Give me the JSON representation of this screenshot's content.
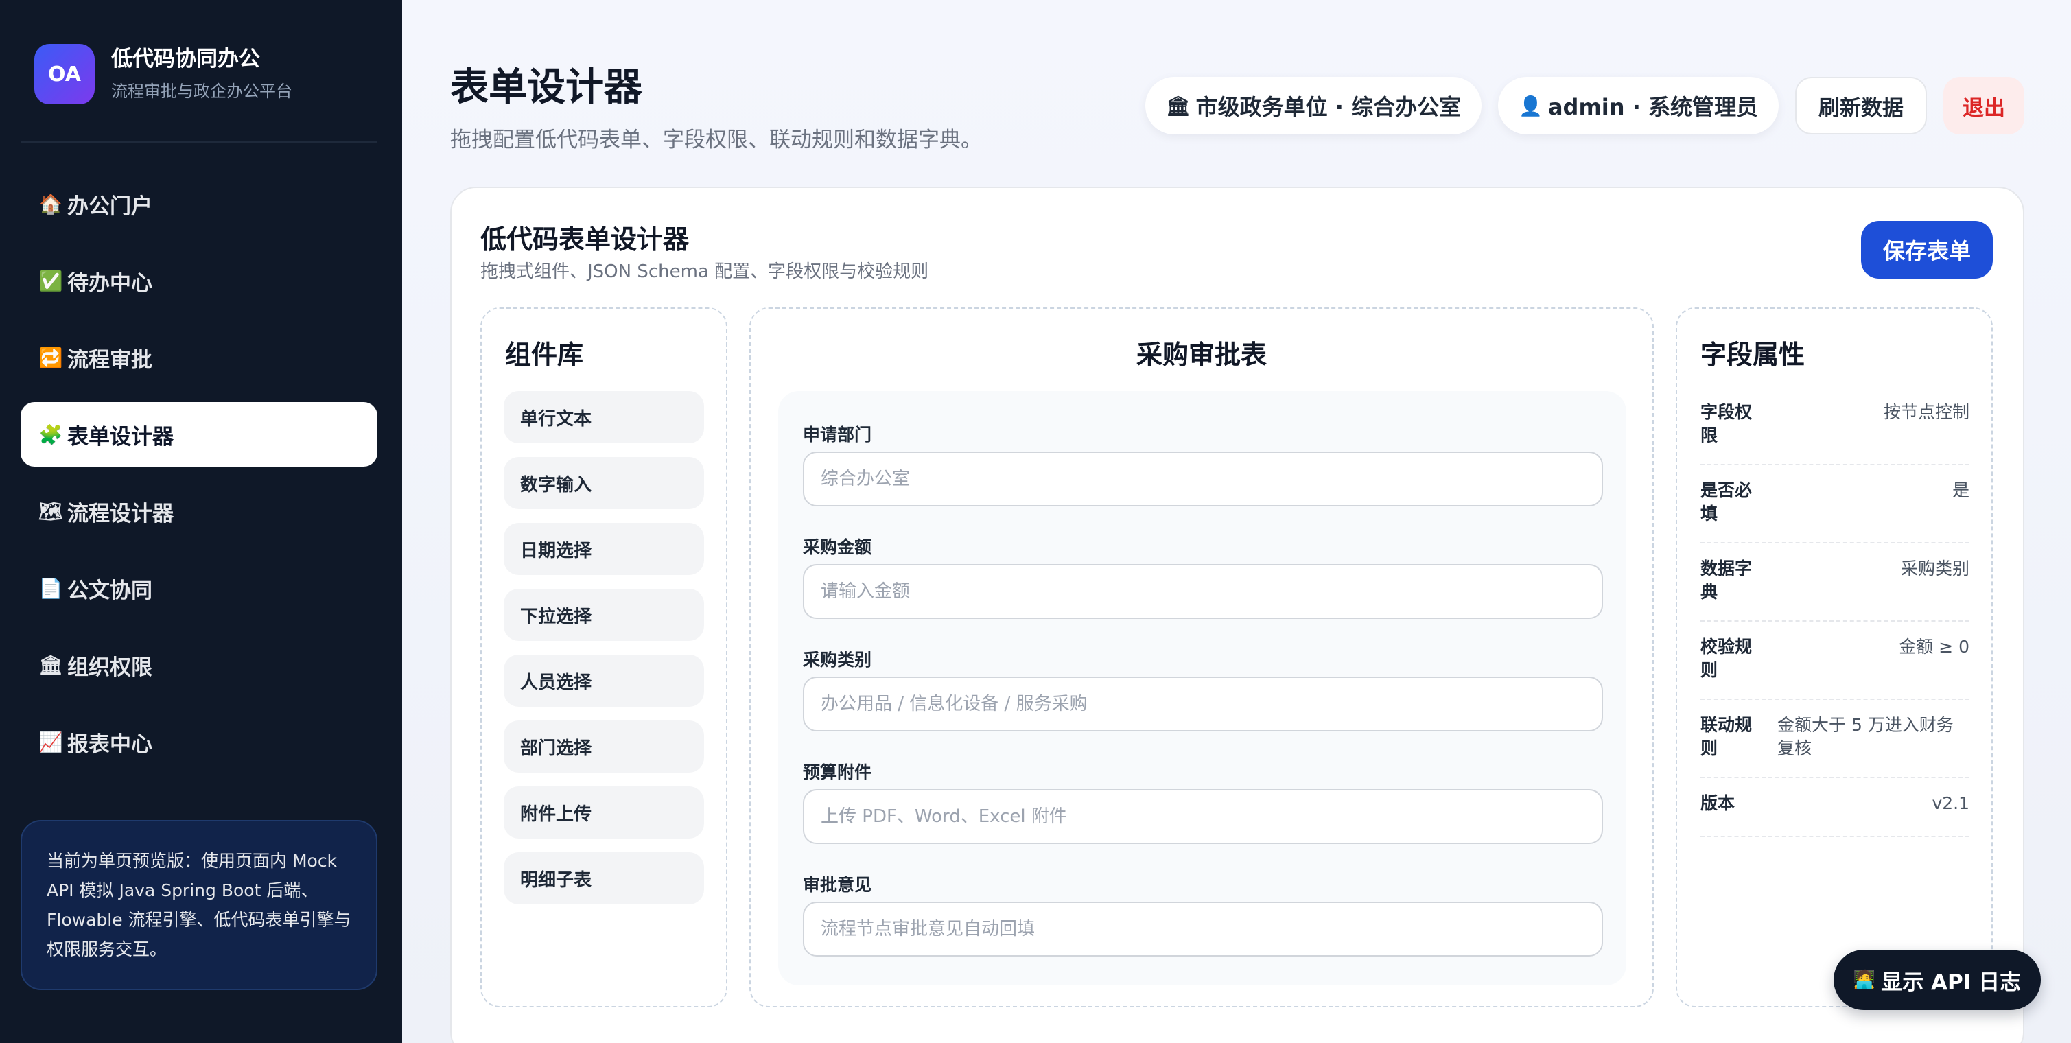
{
  "brand": {
    "logo": "OA",
    "name": "低代码协同办公",
    "subtitle": "流程审批与政企办公平台"
  },
  "sidebar": {
    "items": [
      {
        "icon": "🏠",
        "icon_name": "home-icon",
        "label": "办公门户",
        "active": false
      },
      {
        "icon": "✅",
        "icon_name": "check-icon",
        "label": "待办中心",
        "active": false
      },
      {
        "icon": "🔁",
        "icon_name": "repeat-icon",
        "label": "流程审批",
        "active": false
      },
      {
        "icon": "🧩",
        "icon_name": "puzzle-icon",
        "label": "表单设计器",
        "active": true
      },
      {
        "icon": "🗺",
        "icon_name": "map-icon",
        "label": "流程设计器",
        "active": false
      },
      {
        "icon": "📄",
        "icon_name": "document-icon",
        "label": "公文协同",
        "active": false
      },
      {
        "icon": "🏛",
        "icon_name": "building-icon",
        "label": "组织权限",
        "active": false
      },
      {
        "icon": "📈",
        "icon_name": "chart-icon",
        "label": "报表中心",
        "active": false
      }
    ],
    "note": "当前为单页预览版：使用页面内 Mock API 模拟 Java Spring Boot 后端、Flowable 流程引擎、低代码表单引擎与权限服务交互。"
  },
  "header": {
    "title": "表单设计器",
    "subtitle": "拖拽配置低代码表单、字段权限、联动规则和数据字典。",
    "org": {
      "icon": "🏛",
      "label": "市级政务单位 · 综合办公室"
    },
    "user": {
      "icon": "👤",
      "label": "admin · 系统管理员"
    },
    "refresh_label": "刷新数据",
    "logout_label": "退出"
  },
  "designer": {
    "title": "低代码表单设计器",
    "subtitle": "拖拽式组件、JSON Schema 配置、字段权限与校验规则",
    "save_label": "保存表单",
    "library": {
      "title": "组件库",
      "components": [
        "单行文本",
        "数字输入",
        "日期选择",
        "下拉选择",
        "人员选择",
        "部门选择",
        "附件上传",
        "明细子表"
      ]
    },
    "form": {
      "title": "采购审批表",
      "fields": [
        {
          "label": "申请部门",
          "placeholder": "综合办公室"
        },
        {
          "label": "采购金额",
          "placeholder": "请输入金额"
        },
        {
          "label": "采购类别",
          "placeholder": "办公用品 / 信息化设备 / 服务采购"
        },
        {
          "label": "预算附件",
          "placeholder": "上传 PDF、Word、Excel 附件"
        },
        {
          "label": "审批意见",
          "placeholder": "流程节点审批意见自动回填"
        }
      ]
    },
    "props": {
      "title": "字段属性",
      "rows": [
        {
          "key": "字段权限",
          "value": "按节点控制"
        },
        {
          "key": "是否必填",
          "value": "是"
        },
        {
          "key": "数据字典",
          "value": "采购类别"
        },
        {
          "key": "校验规则",
          "value": "金额 ≥ 0"
        },
        {
          "key": "联动规则",
          "value": "金额大于 5 万进入财务复核"
        },
        {
          "key": "版本",
          "value": "v2.1"
        }
      ]
    }
  },
  "api_button": {
    "icon": "🧑‍💻",
    "label": "显示 API 日志"
  }
}
